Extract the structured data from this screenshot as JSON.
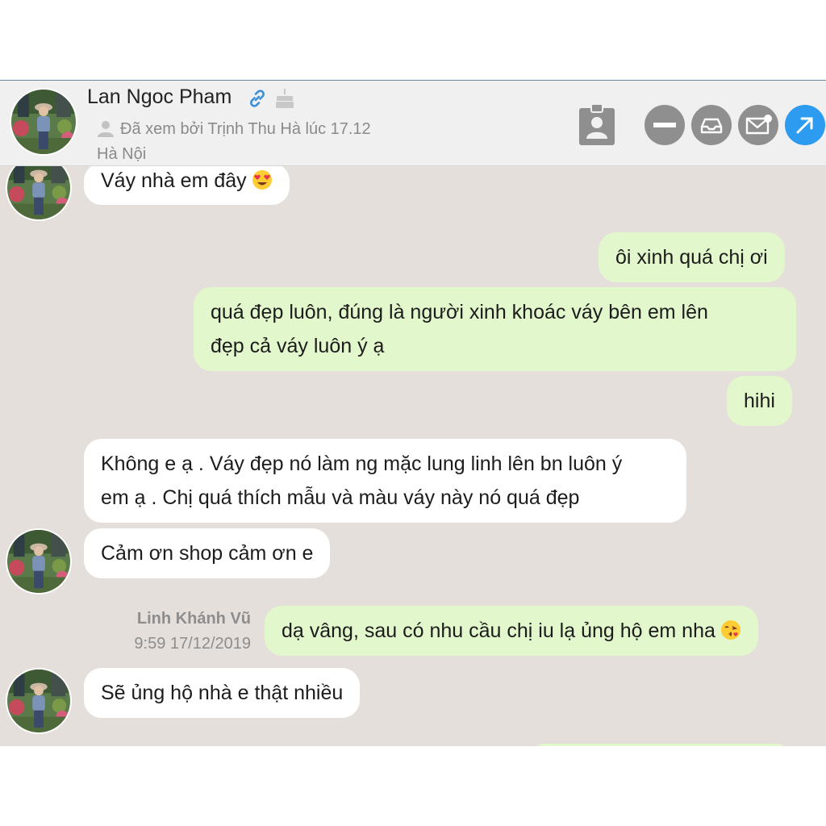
{
  "header": {
    "contact_name": "Lan Ngoc Pham",
    "seen_status": "Đã xem bởi Trịnh Thu Hà lúc 17.12",
    "location": "Hà Nội"
  },
  "messages": [
    {
      "direction": "in",
      "text": "Váy nhà em đây",
      "emoji": "heart-eyes"
    },
    {
      "direction": "out",
      "text": "ôi xinh quá chị ơi"
    },
    {
      "direction": "out",
      "lines": [
        "quá đẹp luôn, đúng là người xinh khoác váy bên em lên",
        "đẹp cả váy luôn ý ạ"
      ]
    },
    {
      "direction": "out",
      "text": "hihi"
    },
    {
      "direction": "in",
      "lines": [
        "Không e ạ . Váy đẹp nó làm ng mặc lung linh lên bn luôn ý",
        "em ạ . Chị quá thích mẫu và màu váy này nó quá đẹp"
      ]
    },
    {
      "direction": "in",
      "text": "Cảm ơn shop cảm ơn e"
    },
    {
      "direction": "out",
      "text": "dạ vâng, sau có nhu cầu chị iu lạ ủng hộ em nha",
      "emoji": "kiss",
      "sender": "Linh Khánh Vũ",
      "time": "9:59 17/12/2019"
    },
    {
      "direction": "in",
      "text": "Sẽ ủng hộ nhà e thật nhiều"
    }
  ],
  "colors": {
    "chat_background": "#e5dfdb",
    "incoming_bubble": "#ffffff",
    "outgoing_bubble": "#e2f7cb",
    "header_background": "#f0f0f0",
    "expand_button": "#2d9bf0",
    "header_buttons": "#8f8f8f"
  },
  "icons": [
    "link-icon",
    "cake-icon",
    "user-icon",
    "contact-card-icon",
    "minimize-icon",
    "archive-icon",
    "mail-icon",
    "expand-icon"
  ]
}
